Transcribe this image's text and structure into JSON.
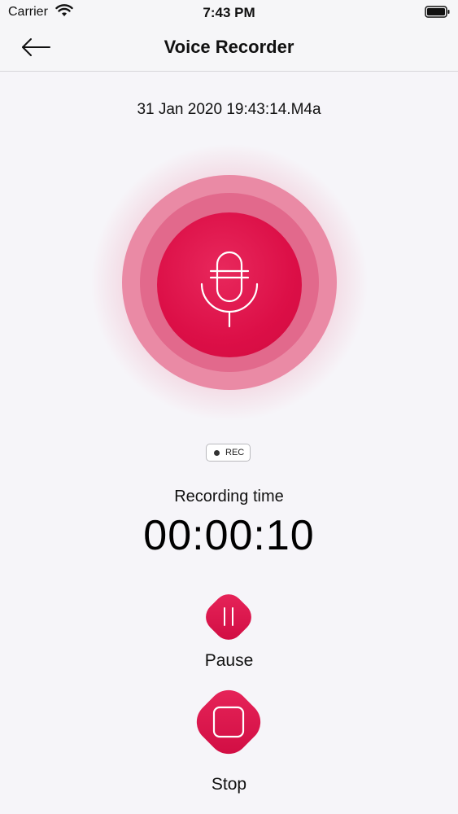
{
  "status_bar": {
    "carrier": "Carrier",
    "time": "7:43 PM"
  },
  "nav": {
    "title": "Voice Recorder",
    "back_icon": "arrow-left-icon"
  },
  "recording": {
    "file_name": "31 Jan 2020 19:43:14.M4a",
    "badge": "REC",
    "time_label": "Recording time",
    "elapsed": "00:00:10"
  },
  "controls": {
    "pause_label": "Pause",
    "stop_label": "Stop"
  },
  "colors": {
    "accent": "#dc0f47",
    "ring_outer": "#ea8aa5",
    "ring_inner": "#e2698c",
    "background": "#f6f5f9"
  }
}
